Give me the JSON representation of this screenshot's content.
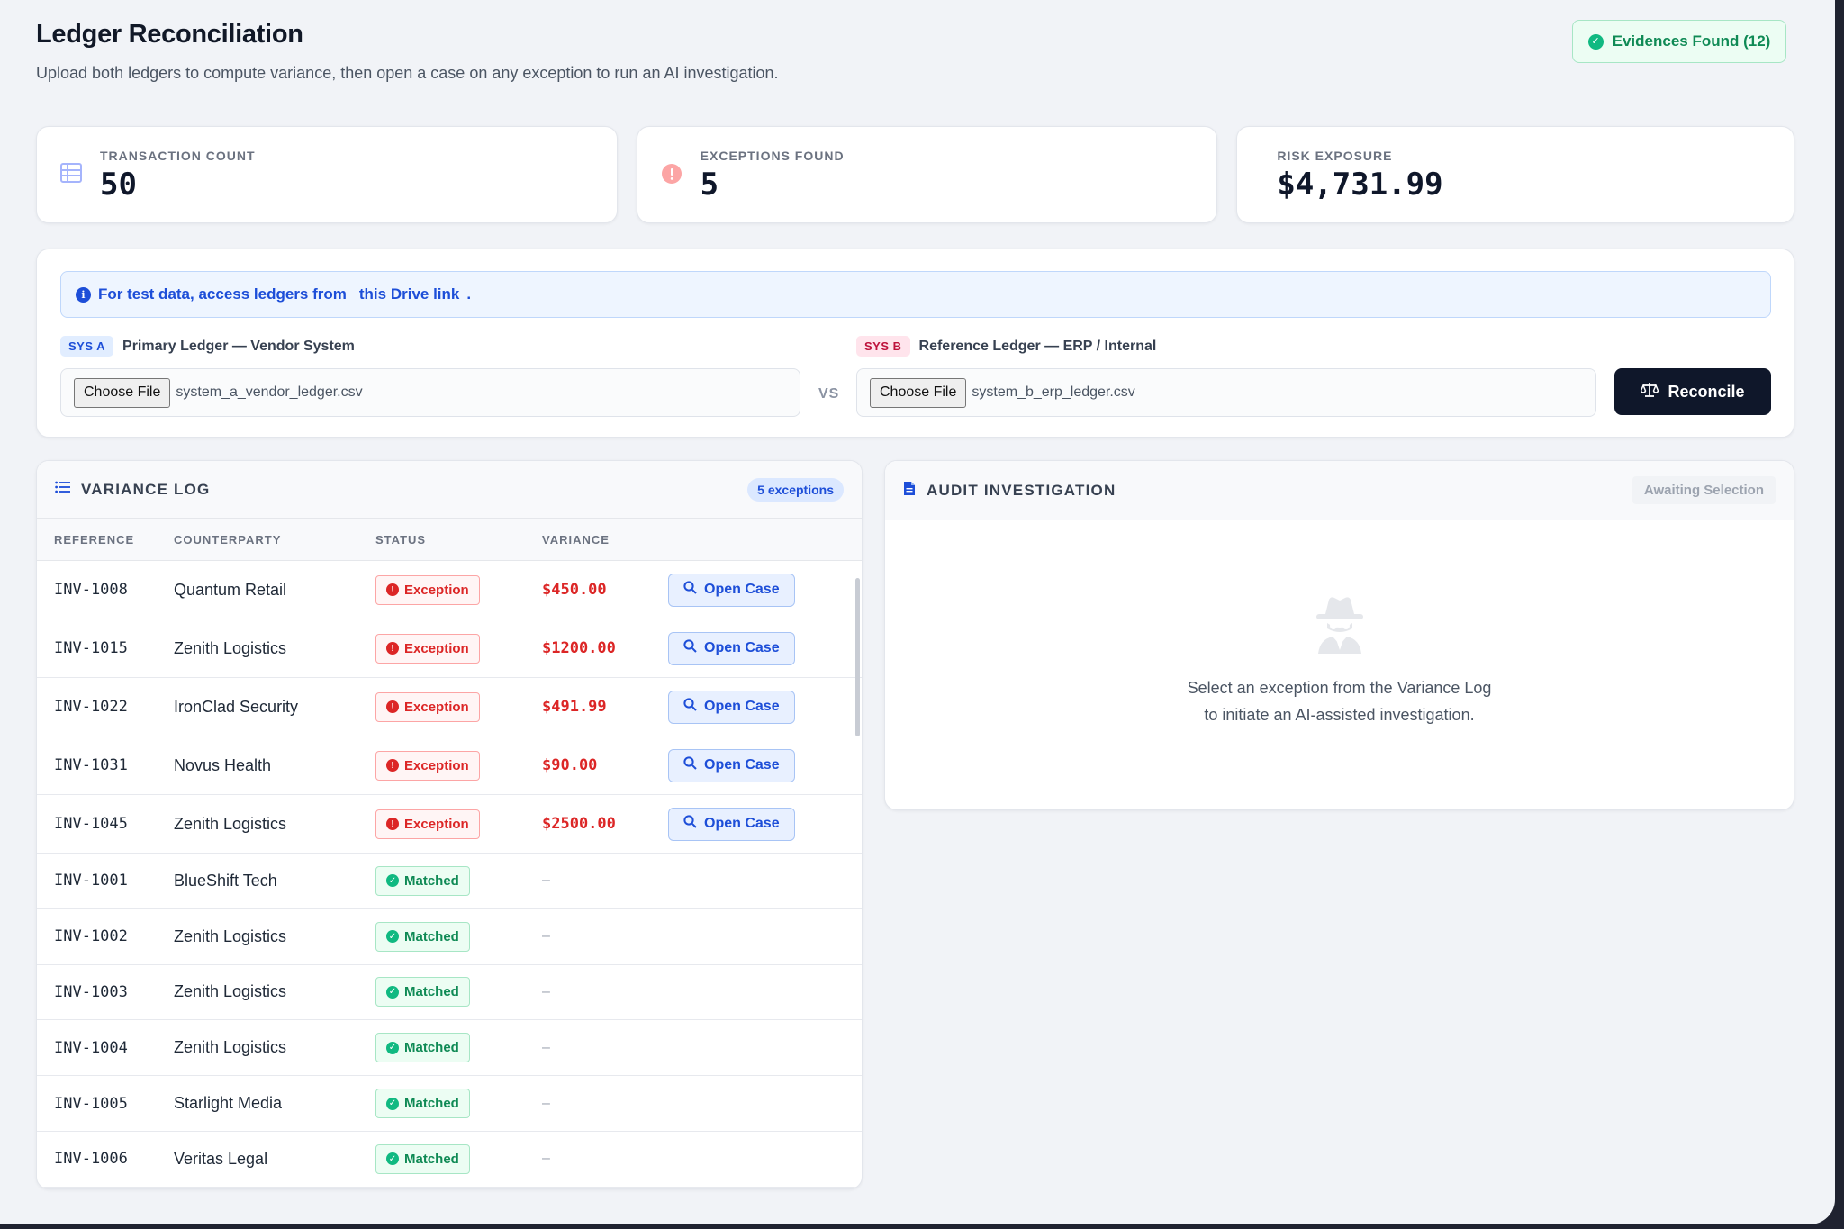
{
  "header": {
    "title": "Ledger Reconciliation",
    "subtitle": "Upload both ledgers to compute variance, then open a case on any exception to run an AI investigation.",
    "evidence_badge": "Evidences Found (12)"
  },
  "stats": [
    {
      "label": "TRANSACTION COUNT",
      "value": "50",
      "icon": "table-icon"
    },
    {
      "label": "EXCEPTIONS FOUND",
      "value": "5",
      "icon": "alert-icon"
    },
    {
      "label": "RISK EXPOSURE",
      "value": "$4,731.99"
    }
  ],
  "upload": {
    "banner_text": "For test data, access ledgers from",
    "banner_link": "this Drive link",
    "banner_end": ".",
    "sys_a": {
      "tag": "SYS A",
      "label": "Primary Ledger — Vendor System",
      "button": "Choose File",
      "file": "system_a_vendor_ledger.csv"
    },
    "sys_b": {
      "tag": "SYS B",
      "label": "Reference Ledger — ERP / Internal",
      "button": "Choose File",
      "file": "system_b_erp_ledger.csv"
    },
    "vs": "VS",
    "reconcile_label": "Reconcile"
  },
  "variance_log": {
    "title": "VARIANCE LOG",
    "badge": "5 exceptions",
    "columns": [
      "REFERENCE",
      "COUNTERPARTY",
      "STATUS",
      "VARIANCE"
    ],
    "open_case_label": "Open Case",
    "exceptions": [
      {
        "ref": "INV-1008",
        "counterparty": "Quantum Retail",
        "status": "Exception",
        "variance": "$450.00"
      },
      {
        "ref": "INV-1015",
        "counterparty": "Zenith Logistics",
        "status": "Exception",
        "variance": "$1200.00"
      },
      {
        "ref": "INV-1022",
        "counterparty": "IronClad Security",
        "status": "Exception",
        "variance": "$491.99"
      },
      {
        "ref": "INV-1031",
        "counterparty": "Novus Health",
        "status": "Exception",
        "variance": "$90.00"
      },
      {
        "ref": "INV-1045",
        "counterparty": "Zenith Logistics",
        "status": "Exception",
        "variance": "$2500.00"
      }
    ],
    "matched": [
      {
        "ref": "INV-1001",
        "counterparty": "BlueShift Tech",
        "status": "Matched",
        "variance": "–"
      },
      {
        "ref": "INV-1002",
        "counterparty": "Zenith Logistics",
        "status": "Matched",
        "variance": "–"
      },
      {
        "ref": "INV-1003",
        "counterparty": "Zenith Logistics",
        "status": "Matched",
        "variance": "–"
      },
      {
        "ref": "INV-1004",
        "counterparty": "Zenith Logistics",
        "status": "Matched",
        "variance": "–"
      },
      {
        "ref": "INV-1005",
        "counterparty": "Starlight Media",
        "status": "Matched",
        "variance": "–"
      },
      {
        "ref": "INV-1006",
        "counterparty": "Veritas Legal",
        "status": "Matched",
        "variance": "–"
      }
    ]
  },
  "audit": {
    "title": "AUDIT INVESTIGATION",
    "status": "Awaiting Selection",
    "empty_line1": "Select an exception from the Variance Log",
    "empty_line2": "to initiate an AI-assisted investigation."
  },
  "colors": {
    "accent": "#1d4ed8",
    "danger": "#dc2626",
    "success": "#10b981",
    "primary_button": "#0f172a",
    "background": "#f1f3f7"
  }
}
